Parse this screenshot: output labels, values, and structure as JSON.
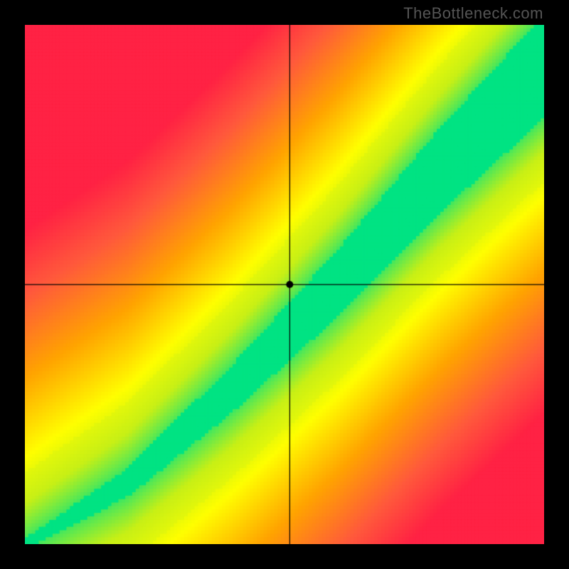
{
  "watermark": "TheBottleneck.com",
  "chart_data": {
    "type": "heatmap",
    "title": "",
    "xlabel": "",
    "ylabel": "",
    "xlim": [
      0,
      100
    ],
    "ylim": [
      0,
      100
    ],
    "description": "Bottleneck balance heatmap. Diagonal narrow band (bottom-left to top-right) is green (00e383) indicating balanced performance ratio. Surrounding the band transitions through yellow to orange to red indicating bottleneck severity. Black crosshair with a dot marks the selected point.",
    "marker": {
      "x": 51,
      "y": 50
    },
    "crosshair": {
      "x": 51,
      "y": 50
    },
    "ideal_band": {
      "center_line": [
        {
          "x": 0,
          "y": 0
        },
        {
          "x": 20,
          "y": 12
        },
        {
          "x": 40,
          "y": 30
        },
        {
          "x": 60,
          "y": 50
        },
        {
          "x": 80,
          "y": 72
        },
        {
          "x": 100,
          "y": 92
        }
      ],
      "half_width_start": 1,
      "half_width_end": 10
    },
    "color_stops": [
      {
        "t": 0.0,
        "color": "#00e383"
      },
      {
        "t": 0.15,
        "color": "#c8f016"
      },
      {
        "t": 0.3,
        "color": "#ffff00"
      },
      {
        "t": 0.55,
        "color": "#ffa500"
      },
      {
        "t": 0.8,
        "color": "#ff5a3c"
      },
      {
        "t": 1.0,
        "color": "#ff2244"
      }
    ]
  }
}
